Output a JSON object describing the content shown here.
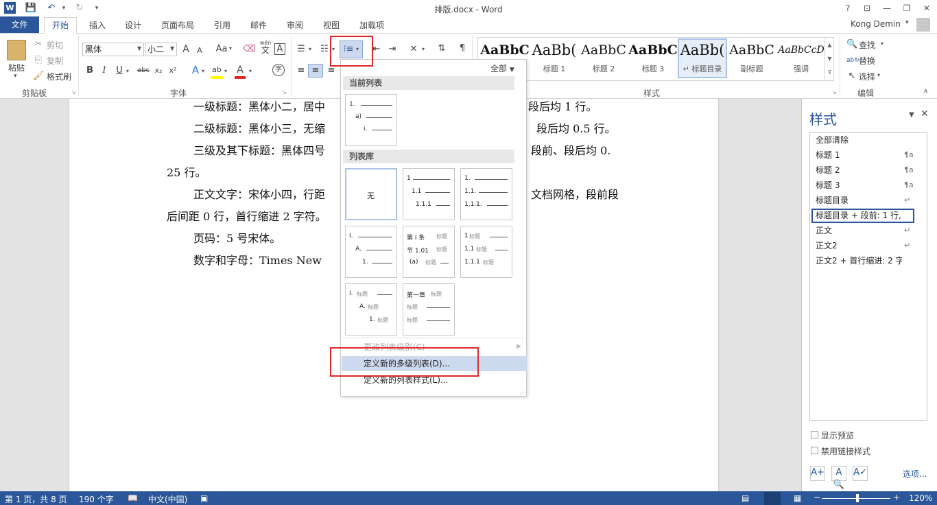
{
  "titlebar": {
    "title": "排版.docx - Word",
    "help": "?",
    "ribbon_display": "⊡",
    "minimize": "—",
    "restore": "❐",
    "close": "✕"
  },
  "tabs": [
    "文件",
    "开始",
    "插入",
    "设计",
    "页面布局",
    "引用",
    "邮件",
    "审阅",
    "视图",
    "加载项"
  ],
  "user": "Kong Demin",
  "clipboard": {
    "paste": "粘贴",
    "cut": "剪切",
    "copy": "复制",
    "format_painter": "格式刷",
    "label": "剪贴板"
  },
  "font": {
    "name": "黑体",
    "size": "小二",
    "grow": "A",
    "shrink": "A",
    "case": "Aa",
    "pinyin_top": "wén",
    "pinyin_bottom": "文",
    "border_char": "A",
    "bold": "B",
    "italic": "I",
    "underline": "U",
    "strike": "abc",
    "sub": "x₂",
    "sup": "x²",
    "effects": "A",
    "highlight": "ab",
    "color": "A",
    "enclose": "字",
    "label": "字体"
  },
  "styles_gallery": {
    "items": [
      {
        "sample": "AaBbC",
        "name": ""
      },
      {
        "sample": "AaBb(",
        "name": "标题 1"
      },
      {
        "sample": "AaBbC",
        "name": "标题 2"
      },
      {
        "sample": "AaBbC",
        "name": "标题 3"
      },
      {
        "sample": "AaBb(",
        "name": "↵ 标题目录"
      },
      {
        "sample": "AaBbC",
        "name": "副标题"
      },
      {
        "sample": "AaBbCcD",
        "name": "强调"
      }
    ],
    "label": "样式"
  },
  "editing": {
    "find": "查找",
    "replace": "替换",
    "select": "选择",
    "label": "编辑"
  },
  "document": {
    "lines": [
      "一级标题：黑体小二，居中",
      "段后均 1 行。",
      "二级标题：黑体小三，无缩",
      "段后均 0.5 行。",
      "三级及其下标题：黑体四号",
      "段前、段后均 0.",
      "25 行。",
      "正文文字：宋体小四，行距",
      "文档网格，段前段",
      "后间距 0 行，首行缩进 2 字符。",
      "页码：5 号宋体。",
      "数字和字母：Times  New"
    ]
  },
  "dropdown": {
    "filter": "全部",
    "current_header": "当前列表",
    "library_header": "列表库",
    "none_label": "无",
    "change_level": "更改列表级别(C)",
    "define_multilevel": "定义新的多级列表(D)...",
    "define_style": "定义新的列表样式(L)..."
  },
  "lists": {
    "current": [
      "1.",
      "a)",
      "i."
    ],
    "numeric": [
      "1",
      "1.1",
      "1.1.1"
    ],
    "numeric_dot": [
      "1.",
      "1.1.",
      "1.1.1."
    ],
    "mixed": [
      "I.",
      "A.",
      "1."
    ],
    "article": [
      "第 Ⅰ 条",
      "节 1.01",
      "(a)"
    ],
    "heading_num": [
      "1",
      "1.1",
      "1.1.1"
    ],
    "roman_heading": [
      "I.",
      "A.",
      "1."
    ],
    "chapter": [
      "第一章",
      "标题",
      "标题"
    ],
    "heading_word": "标题",
    "levels": [
      "1",
      "2",
      "3"
    ]
  },
  "styles_pane": {
    "title": "样式",
    "items": [
      {
        "name": "全部清除",
        "mark": ""
      },
      {
        "name": "标题 1",
        "mark": "¶a"
      },
      {
        "name": "标题 2",
        "mark": "¶a"
      },
      {
        "name": "标题 3",
        "mark": "¶a"
      },
      {
        "name": "标题目录",
        "mark": "↵"
      },
      {
        "name": "标题目录 + 段前: 1 行,",
        "mark": ""
      },
      {
        "name": "正文",
        "mark": "↵"
      },
      {
        "name": "正文2",
        "mark": "↵"
      },
      {
        "name": "正文2 + 首行缩进:  2 字",
        "mark": ""
      }
    ],
    "show_preview": "显示预览",
    "disable_linked": "禁用链接样式",
    "options": "选项..."
  },
  "statusbar": {
    "page": "第 1 页，共 8 页",
    "words": "190 个字",
    "language": "中文(中国)",
    "zoom": "120%",
    "zoom_out": "−",
    "zoom_in": "+"
  },
  "colors": {
    "accent": "#2b579a",
    "highlight_box": "#e0282b",
    "hover": "#cdd9ee"
  }
}
